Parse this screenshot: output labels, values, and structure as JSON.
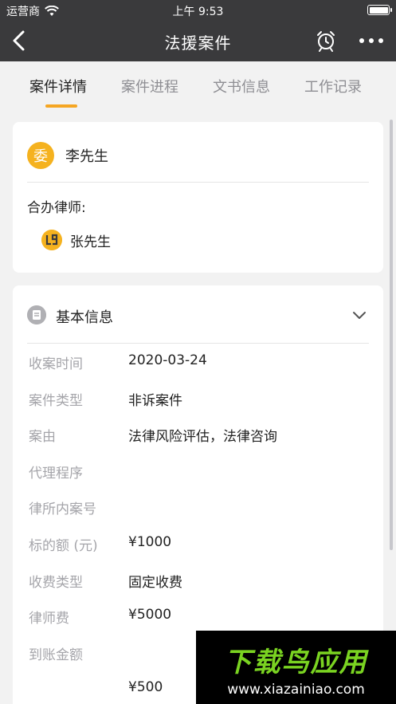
{
  "status_bar": {
    "carrier": "运营商",
    "time": "上午 9:53"
  },
  "nav": {
    "title": "法援案件",
    "back_icon": "chevron-left-icon",
    "alarm_icon": "alarm-clock-icon",
    "more_icon": "ellipsis-icon"
  },
  "tabs": [
    {
      "label": "案件详情",
      "active": true
    },
    {
      "label": "案件进程",
      "active": false
    },
    {
      "label": "文书信息",
      "active": false
    },
    {
      "label": "工作记录",
      "active": false
    }
  ],
  "client": {
    "avatar_char": "委",
    "name": "李先生"
  },
  "co_counsel": {
    "label": "合办律师:",
    "lawyer_name": "张先生"
  },
  "basic_info": {
    "title": "基本信息",
    "rows": [
      {
        "key": "收案时间",
        "value": "2020-03-24"
      },
      {
        "key": "案件类型",
        "value": "非诉案件"
      },
      {
        "key": "案由",
        "value": "法律风险评估，法律咨询"
      },
      {
        "key": "代理程序",
        "value": ""
      },
      {
        "key": "律所内案号",
        "value": ""
      },
      {
        "key": "标的额 (元)",
        "value": "¥1000"
      },
      {
        "key": "收费类型",
        "value": "固定收费"
      },
      {
        "key": "律师费",
        "value": "¥5000"
      },
      {
        "key": "到账金额",
        "value": ""
      },
      {
        "key": "",
        "value": "¥500"
      }
    ]
  },
  "watermark": {
    "brand": "下载鸟应用",
    "url": "www.xiazainiao.com"
  },
  "colors": {
    "accent": "#f5a623",
    "header_bg": "#3a3a3c",
    "brand_green": "#7ad321"
  }
}
